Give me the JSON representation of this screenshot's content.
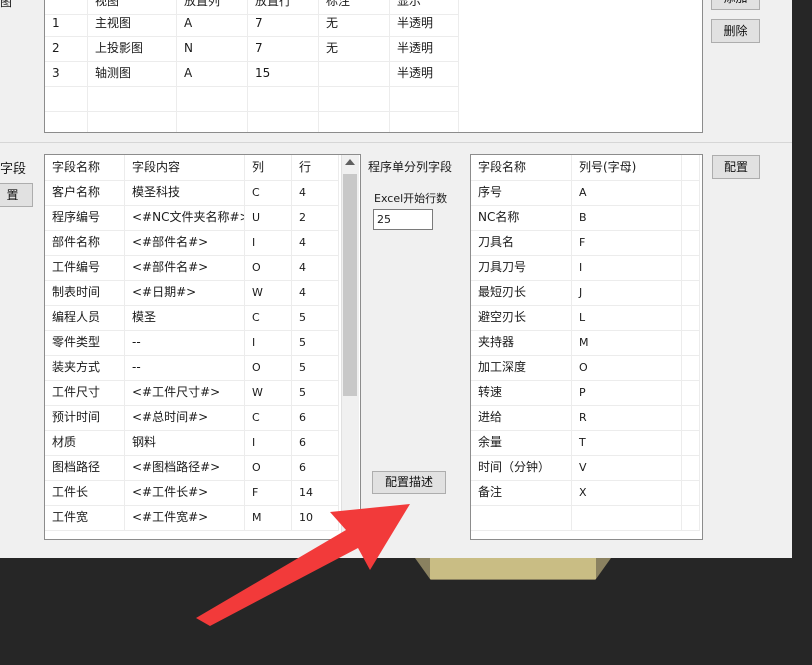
{
  "top_table": {
    "headers": [
      "视图",
      "放置列",
      "放置行",
      "标注",
      "显示"
    ],
    "rows": [
      [
        "1",
        "主视图",
        "A",
        "7",
        "无",
        "半透明"
      ],
      [
        "2",
        "上投影图",
        "N",
        "7",
        "无",
        "半透明"
      ],
      [
        "3",
        "轴测图",
        "A",
        "15",
        "",
        "半透明"
      ]
    ]
  },
  "left_labels": {
    "section_label": "截图",
    "fields_label": "字段"
  },
  "buttons": {
    "add": "添加",
    "delete": "删除",
    "config_left": "置",
    "config_right": "配置",
    "config_desc": "配置描述"
  },
  "fields_table": {
    "headers": [
      "字段名称",
      "字段内容",
      "列",
      "行"
    ],
    "rows": [
      [
        "客户名称",
        "模圣科技",
        "C",
        "4"
      ],
      [
        "程序编号",
        "<#NC文件夹名称#>",
        "U",
        "2"
      ],
      [
        "部件名称",
        "<#部件名#>",
        "I",
        "4"
      ],
      [
        "工件编号",
        "<#部件名#>",
        "O",
        "4"
      ],
      [
        "制表时间",
        "<#日期#>",
        "W",
        "4"
      ],
      [
        "编程人员",
        "模圣",
        "C",
        "5"
      ],
      [
        "零件类型",
        "--",
        "I",
        "5"
      ],
      [
        "装夹方式",
        "--",
        "O",
        "5"
      ],
      [
        "工件尺寸",
        "<#工件尺寸#>",
        "W",
        "5"
      ],
      [
        "预计时间",
        "<#总时间#>",
        "C",
        "6"
      ],
      [
        "材质",
        "钢料",
        "I",
        "6"
      ],
      [
        "图档路径",
        "<#图档路径#>",
        "O",
        "6"
      ],
      [
        "工件长",
        "<#工件长#>",
        "F",
        "14"
      ],
      [
        "工件宽",
        "<#工件宽#>",
        "M",
        "10"
      ]
    ]
  },
  "middle": {
    "title": "程序单分列字段",
    "excel_label": "Excel开始行数",
    "excel_value": "25"
  },
  "columns_table": {
    "headers": [
      "字段名称",
      "列号(字母)"
    ],
    "rows": [
      [
        "序号",
        "A"
      ],
      [
        "NC名称",
        "B"
      ],
      [
        "刀具名",
        "F"
      ],
      [
        "刀具刀号",
        "I"
      ],
      [
        "最短刃长",
        "J"
      ],
      [
        "避空刃长",
        "L"
      ],
      [
        "夹持器",
        "M"
      ],
      [
        "加工深度",
        "O"
      ],
      [
        "转速",
        "P"
      ],
      [
        "进给",
        "R"
      ],
      [
        "余量",
        "T"
      ],
      [
        "时间（分钟）",
        "V"
      ],
      [
        "备注",
        "X"
      ]
    ]
  }
}
